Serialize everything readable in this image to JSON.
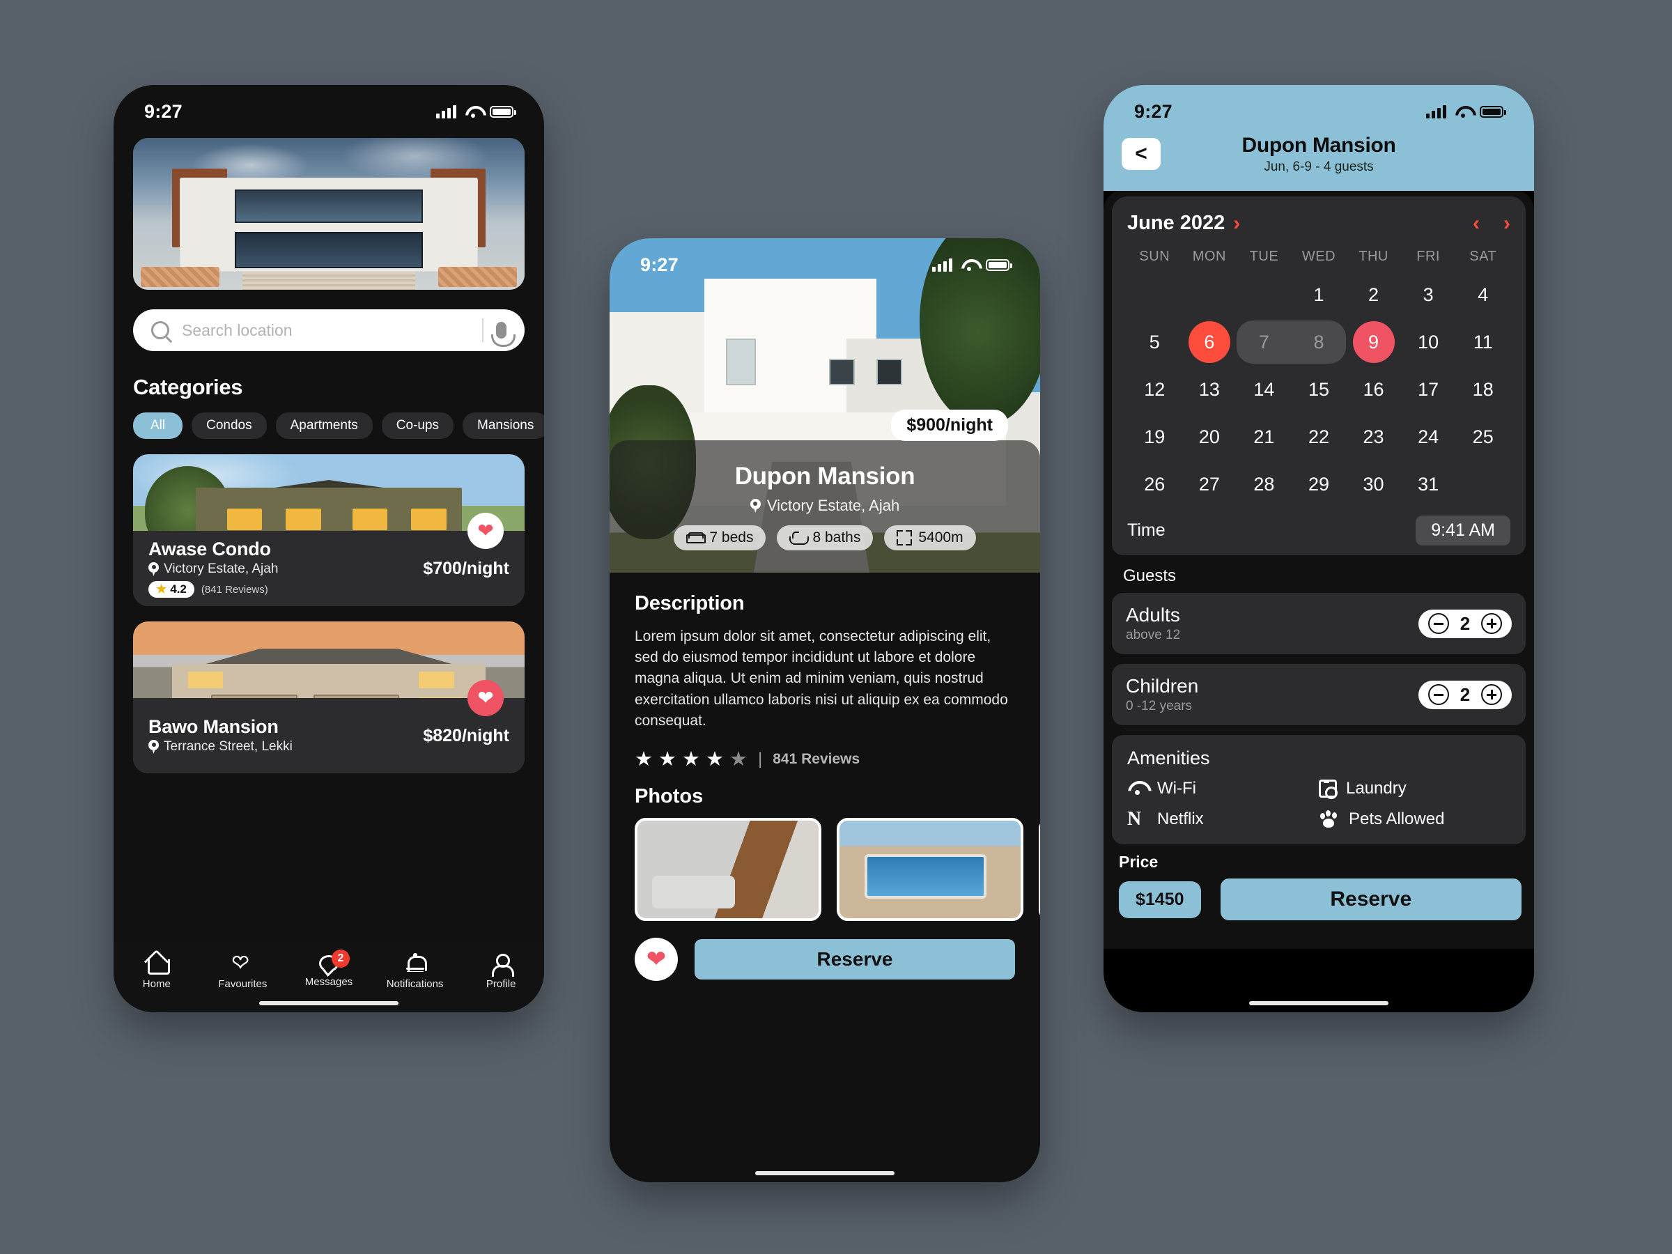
{
  "home": {
    "status": {
      "time": "9:27"
    },
    "search": {
      "placeholder": "Search location",
      "value": ""
    },
    "categories_title": "Categories",
    "chips": [
      {
        "label": "All",
        "active": true
      },
      {
        "label": "Condos",
        "active": false
      },
      {
        "label": "Apartments",
        "active": false
      },
      {
        "label": "Co-ups",
        "active": false
      },
      {
        "label": "Mansions",
        "active": false
      }
    ],
    "listings": [
      {
        "name": "Awase Condo",
        "location": "Victory Estate, Ajah",
        "rating": "4.2",
        "reviews": "(841 Reviews)",
        "price": "$700/night",
        "favorite": true
      },
      {
        "name": "Bawo Mansion",
        "location": "Terrance Street, Lekki",
        "price": "$820/night",
        "favorite": true
      }
    ],
    "tabs": [
      {
        "label": "Home",
        "icon": "home-icon",
        "badge": ""
      },
      {
        "label": "Favourites",
        "icon": "heart-icon",
        "badge": ""
      },
      {
        "label": "Messages",
        "icon": "chat-icon",
        "badge": "2"
      },
      {
        "label": "Notifications",
        "icon": "bell-icon",
        "badge": ""
      },
      {
        "label": "Profile",
        "icon": "user-icon",
        "badge": ""
      }
    ]
  },
  "detail": {
    "status": {
      "time": "9:27"
    },
    "price_tag": "$900/night",
    "title": "Dupon Mansion",
    "location": "Victory Estate, Ajah",
    "specs": [
      {
        "label": "7 beds",
        "icon": "bed-icon"
      },
      {
        "label": "8 baths",
        "icon": "bath-icon"
      },
      {
        "label": "5400m",
        "icon": "area-icon"
      }
    ],
    "description_title": "Description",
    "description": "Lorem ipsum dolor sit amet, consectetur adipiscing elit, sed do eiusmod tempor incididunt ut labore et dolore magna aliqua. Ut enim ad minim veniam, quis nostrud exercitation ullamco laboris nisi ut aliquip ex ea commodo consequat.",
    "stars_filled": 4,
    "stars_total": 5,
    "reviews": "841 Reviews",
    "photos_title": "Photos",
    "photos": [
      "living-room-photo",
      "pool-photo",
      "lounge-photo"
    ],
    "reserve_label": "Reserve",
    "favorite": true
  },
  "booking": {
    "status": {
      "time": "9:27"
    },
    "back_label": "<",
    "title": "Dupon Mansion",
    "subtitle": "Jun, 6-9 - 4 guests",
    "calendar": {
      "month": "June 2022",
      "weekdays": [
        "SUN",
        "MON",
        "TUE",
        "WED",
        "THU",
        "FRI",
        "SAT"
      ],
      "lead_blanks": 3,
      "days": [
        1,
        2,
        3,
        4,
        5,
        6,
        7,
        8,
        9,
        10,
        11,
        12,
        13,
        14,
        15,
        16,
        17,
        18,
        19,
        20,
        21,
        22,
        23,
        24,
        25,
        26,
        27,
        28,
        29,
        30,
        31
      ],
      "selected_start": 6,
      "selected_end": 9,
      "range": [
        7,
        8
      ],
      "accent_start": "#ff4d3d",
      "accent_end": "#ef5364"
    },
    "time_label": "Time",
    "time_value": "9:41 AM",
    "guests_label": "Guests",
    "guest_rows": [
      {
        "name": "Adults",
        "sub": "above 12",
        "value": "2"
      },
      {
        "name": "Children",
        "sub": "0 -12 years",
        "value": "2"
      }
    ],
    "amenities_title": "Amenities",
    "amenities": [
      {
        "label": "Wi-Fi",
        "icon": "wifi-icon"
      },
      {
        "label": "Laundry",
        "icon": "laundry-icon"
      },
      {
        "label": "Netflix",
        "icon": "netflix-icon"
      },
      {
        "label": "Pets Allowed",
        "icon": "paw-icon"
      }
    ],
    "price_label": "Price",
    "price_value": "$1450",
    "reserve_label": "Reserve"
  },
  "theme": {
    "accent_blue": "#8cc0d6",
    "accent_red": "#ff4d3d",
    "heart_pink": "#ef5364",
    "badge_red": "#ef3b2e",
    "page_bg": "#58616a",
    "phone_bg": "#111112",
    "card_bg": "#2c2c2e"
  }
}
